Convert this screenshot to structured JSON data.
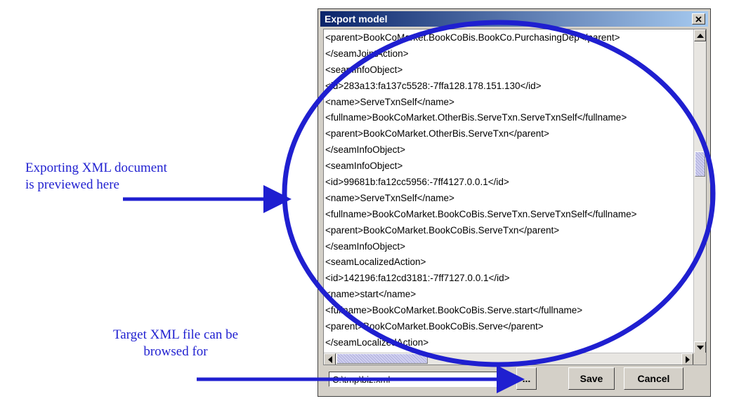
{
  "annotations": {
    "preview": [
      "Exporting XML document",
      "is previewed here"
    ],
    "browse": [
      "Target XML file can be",
      "browsed for"
    ]
  },
  "dialog": {
    "title": "Export model",
    "close_glyph": "×",
    "xml_lines": [
      "<parent>BookCoMarket.BookCoBis.BookCo.PurchasingDep</parent>",
      "</seamJointAction>",
      "<seamInfoObject>",
      "<id>283a13:fa137c5528:-7ffa128.178.151.130</id>",
      "<name>ServeTxnSelf</name>",
      "<fullname>BookCoMarket.OtherBis.ServeTxn.ServeTxnSelf</fullname>",
      "<parent>BookCoMarket.OtherBis.ServeTxn</parent>",
      "</seamInfoObject>",
      "<seamInfoObject>",
      "<id>99681b:fa12cc5956:-7ff4127.0.0.1</id>",
      "<name>ServeTxnSelf</name>",
      "<fullname>BookCoMarket.BookCoBis.ServeTxn.ServeTxnSelf</fullname>",
      "<parent>BookCoMarket.BookCoBis.ServeTxn</parent>",
      "</seamInfoObject>",
      "<seamLocalizedAction>",
      "<id>142196:fa12cd3181:-7ff7127.0.0.1</id>",
      "<name>start</name>",
      "<fullname>BookCoMarket.BookCoBis.Serve.start</fullname>",
      "<parent>BookCoMarket.BookCoBis.Serve</parent>",
      "</seamLocalizedAction>"
    ],
    "path_value": "C:\\tmp\\biz.xml",
    "browse_label": "...",
    "save_label": "Save",
    "cancel_label": "Cancel"
  },
  "colors": {
    "annotation_blue": "#1f1fd0",
    "title_bar": "#0a246a",
    "dialog_face": "#d4d0c8"
  }
}
